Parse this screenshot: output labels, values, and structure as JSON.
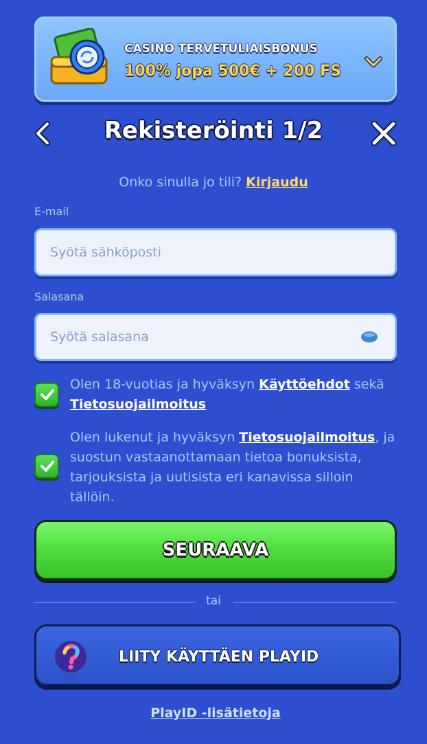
{
  "bonus": {
    "title": "CASINO TERVETULIAISBONUS",
    "offer": "100% jopa 500€ + 200 FS",
    "icon": "gift-coin-icon"
  },
  "header": {
    "title": "Rekisteröinti 1/2",
    "back_icon": "chevron-left-icon",
    "close_icon": "close-icon"
  },
  "login_prompt": {
    "text": "Onko sinulla jo tili?",
    "link": "Kirjaudu"
  },
  "email": {
    "label": "E-mail",
    "placeholder": "Syötä sähköposti",
    "value": ""
  },
  "password": {
    "label": "Salasana",
    "placeholder": "Syötä salasana",
    "value": "",
    "toggle_icon": "eye-icon"
  },
  "consents": [
    {
      "checked": true,
      "text_pre": "Olen 18-vuotias ja hyväksyn",
      "link1": "Käyttöehdot",
      "text_mid": "sekä",
      "link2": "Tietosuojailmoitus"
    },
    {
      "checked": true,
      "text_pre": "Olen lukenut ja hyväksyn",
      "link1": "Tietosuojailmoitus",
      "text_post": ", ja suostun vastaanottamaan tietoa bonuksista, tarjouksista ja uutisista eri kanavissa silloin tällöin."
    }
  ],
  "next_button": "SEURAAVA",
  "or_text": "tai",
  "playid_button": "LIITY KÄYTTÄEN PLAYID",
  "playid_info": "PlayID -lisätietoja",
  "colors": {
    "background": "#2d4fcf",
    "accent_green": "#4fdc3e",
    "link_yellow": "#ffd870"
  }
}
